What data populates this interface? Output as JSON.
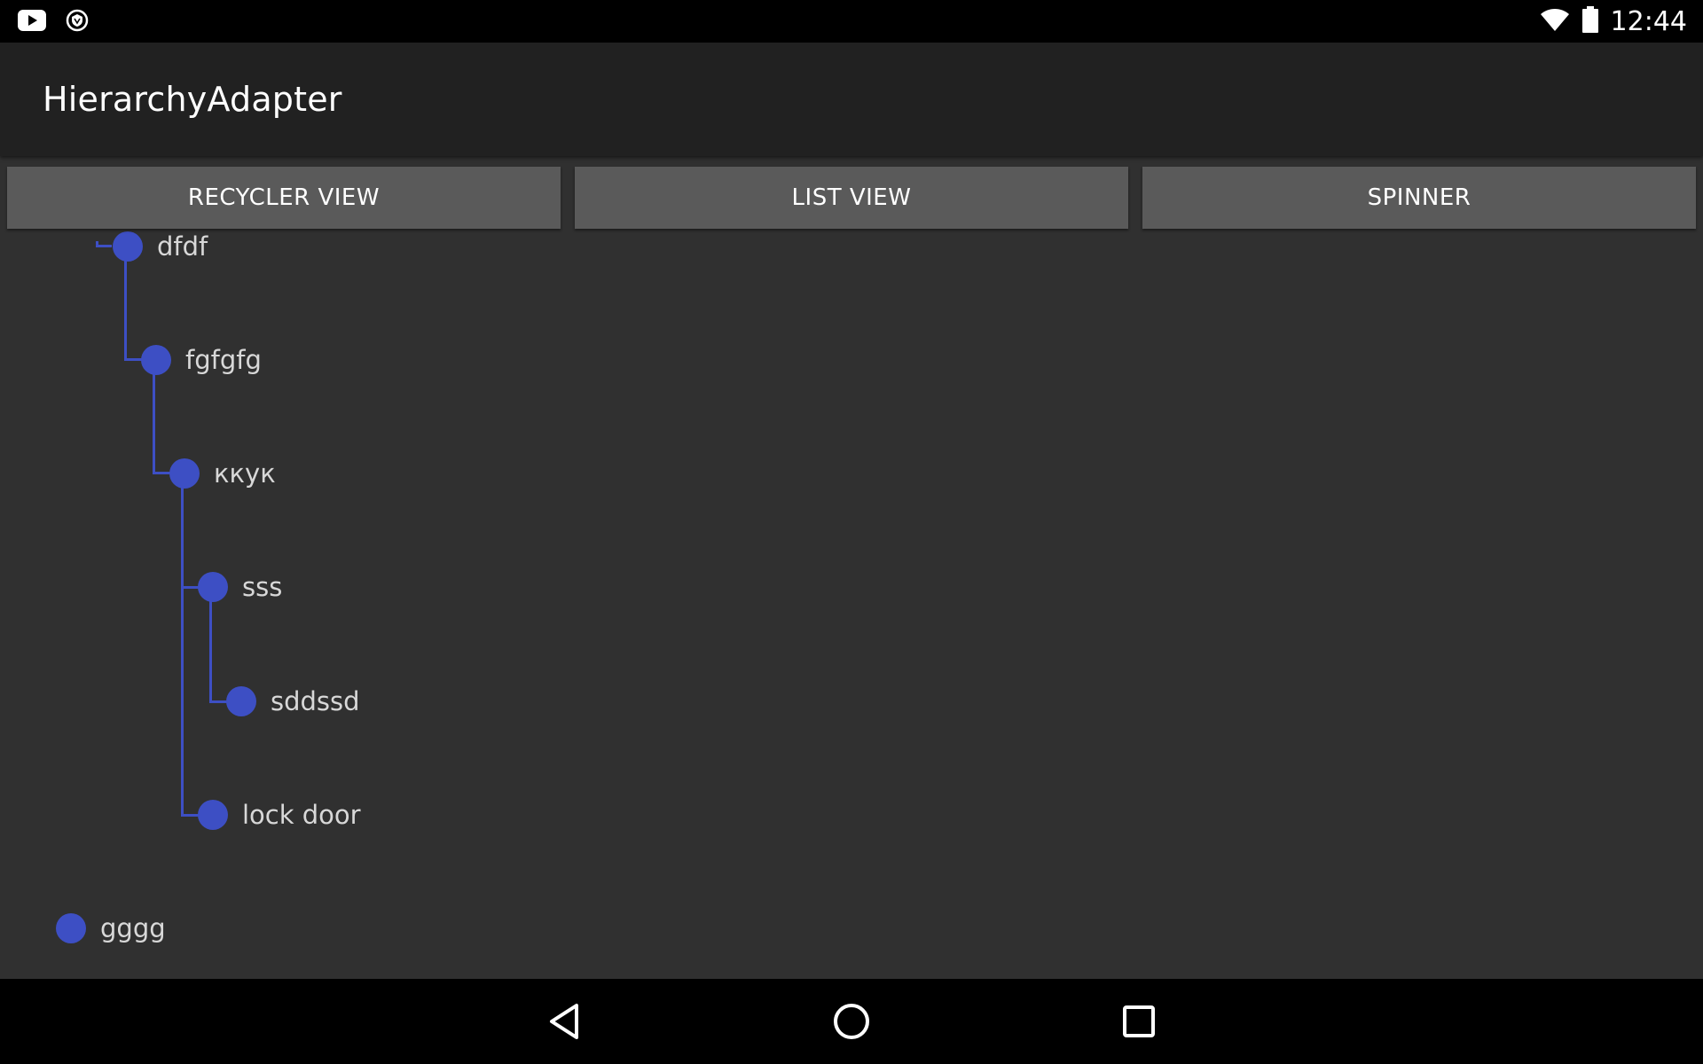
{
  "status_bar": {
    "time": "12:44",
    "left_icons": [
      "youtube-icon",
      "vpn-shield-icon"
    ],
    "right_icons": [
      "wifi-icon",
      "battery-icon"
    ]
  },
  "toolbar": {
    "title": "HierarchyAdapter"
  },
  "buttons": {
    "recycler_view": "RECYCLER VIEW",
    "list_view": "LIST VIEW",
    "spinner": "SPINNER"
  },
  "tree": {
    "items": [
      {
        "label": "dfdf",
        "depth": 2
      },
      {
        "label": "fgfgfg",
        "depth": 3
      },
      {
        "label": "ккук",
        "depth": 4
      },
      {
        "label": "sss",
        "depth": 5
      },
      {
        "label": "sddssd",
        "depth": 6
      },
      {
        "label": "lock door",
        "depth": 5
      },
      {
        "label": "gggg",
        "depth": 0
      }
    ]
  },
  "colors": {
    "accent": "#3d4fc4",
    "background": "#303030",
    "toolbar": "#212121",
    "button": "#5a5a5a"
  },
  "nav_bar": {
    "icons": [
      "back-icon",
      "home-icon",
      "recents-icon"
    ]
  }
}
